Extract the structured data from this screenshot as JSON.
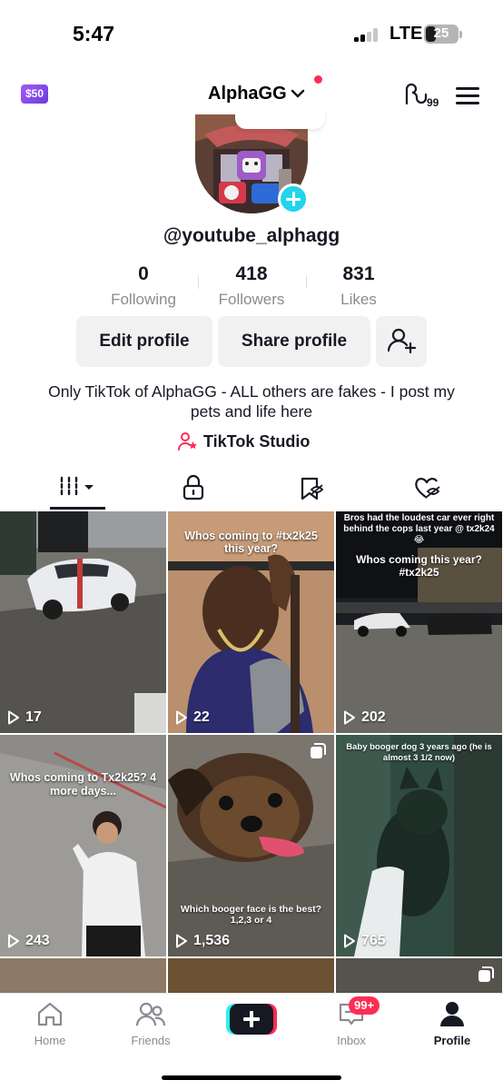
{
  "status_bar": {
    "time": "5:47",
    "network": "LTE",
    "battery": "25"
  },
  "header": {
    "coin_badge": "$50",
    "username": "AlphaGG",
    "icons": [
      "coin-icon",
      "chevron-down-icon",
      "gg-activity-icon",
      "menu-icon"
    ],
    "notification_dot_color": "#fe2c55"
  },
  "profile": {
    "handle": "@youtube_alphagg",
    "stats": [
      {
        "value": "0",
        "label": "Following"
      },
      {
        "value": "418",
        "label": "Followers"
      },
      {
        "value": "831",
        "label": "Likes"
      }
    ],
    "buttons": {
      "edit": "Edit profile",
      "share": "Share profile"
    },
    "bio": "Only TikTok of AlphaGG - ALL others are fakes - I post my pets and life here",
    "studio_link": "TikTok Studio"
  },
  "tabs": [
    {
      "icon": "videos-grid-icon",
      "active": true
    },
    {
      "icon": "lock-icon",
      "active": false
    },
    {
      "icon": "saved-icon",
      "active": false
    },
    {
      "icon": "liked-icon",
      "active": false
    }
  ],
  "videos": [
    {
      "caption": "",
      "views": "17",
      "multi": false
    },
    {
      "caption": "Whos coming to #tx2k25 this year?",
      "views": "22",
      "multi": false
    },
    {
      "caption": "Bros had the loudest car ever right behind the cops last year @ tx2k24😂",
      "caption2": "Whos coming this year? #tx2k25",
      "views": "202",
      "multi": false
    },
    {
      "caption": "Whos coming to Tx2k25? 4 more days...",
      "views": "243",
      "multi": false
    },
    {
      "caption": "Which booger face is the best? 1,2,3 or 4",
      "views": "1,536",
      "multi": true
    },
    {
      "caption": "Baby booger dog 3 years ago (he is almost 3 1/2 now)",
      "views": "765",
      "multi": false
    }
  ],
  "bottom_nav": {
    "items": [
      {
        "label": "Home",
        "icon": "home-icon"
      },
      {
        "label": "Friends",
        "icon": "friends-icon"
      },
      {
        "label": "Inbox",
        "icon": "inbox-icon"
      },
      {
        "label": "Profile",
        "icon": "profile-icon"
      }
    ],
    "inbox_badge": "99+"
  },
  "colors": {
    "accent": "#fe2c55",
    "cyan": "#25f4ee",
    "text": "#161823",
    "muted": "#8a8b91"
  }
}
